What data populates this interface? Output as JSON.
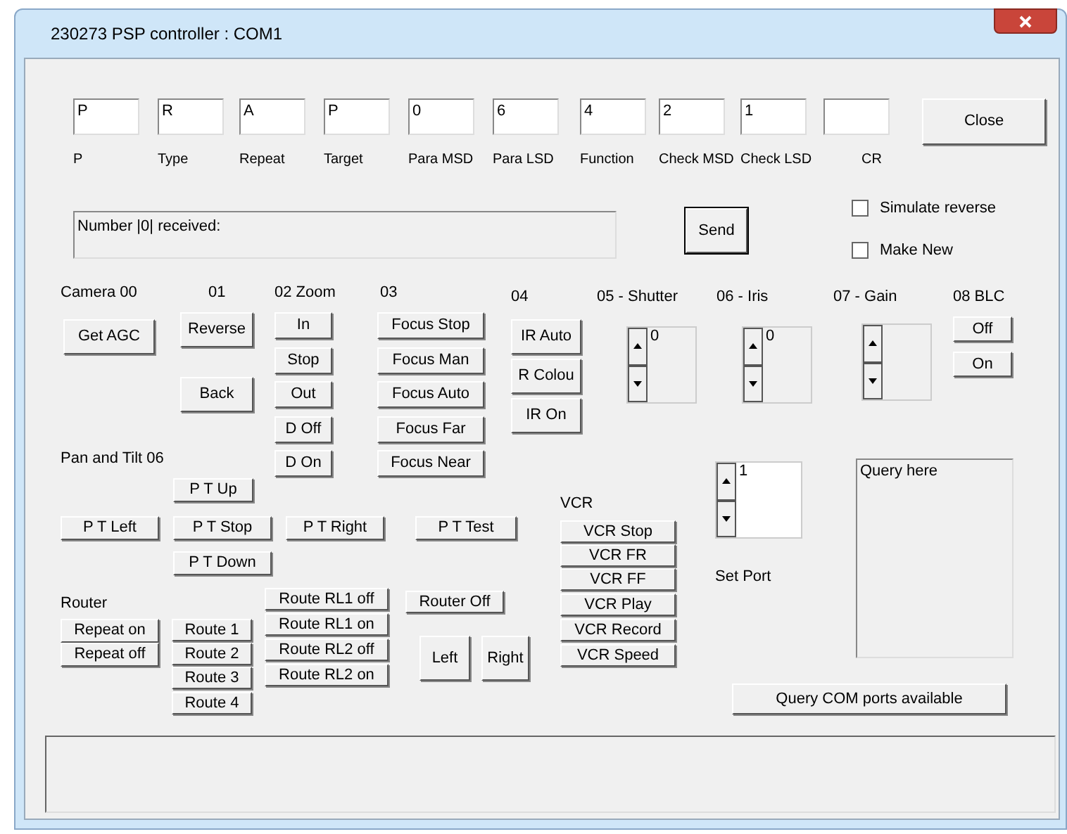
{
  "window": {
    "title": "230273 PSP controller : COM1"
  },
  "fields": [
    {
      "value": "P",
      "label": "P"
    },
    {
      "value": "R",
      "label": "Type"
    },
    {
      "value": "A",
      "label": "Repeat"
    },
    {
      "value": "P",
      "label": "Target"
    },
    {
      "value": "0",
      "label": "Para MSD"
    },
    {
      "value": "6",
      "label": "Para LSD"
    },
    {
      "value": "4",
      "label": "Function"
    },
    {
      "value": "2",
      "label": "Check MSD"
    },
    {
      "value": "1",
      "label": "Check LSD"
    },
    {
      "label": "CR"
    }
  ],
  "close_button": "Close",
  "message_box": "Number |0| received:",
  "send_button": "Send",
  "checkboxes": [
    {
      "label": "Simulate reverse",
      "checked": false
    },
    {
      "label": "Make New",
      "checked": false
    }
  ],
  "headings": [
    "Camera 00",
    "01",
    "02 Zoom",
    "03",
    "04",
    "05 - Shutter",
    "06 - Iris",
    "07 - Gain",
    "08 BLC",
    "Pan and Tilt 06",
    "VCR",
    "Router",
    "Set Port"
  ],
  "buttons": [
    "Get AGC",
    "Reverse",
    "Back",
    "In",
    "Stop",
    "Out",
    "D Off",
    "D On",
    "Focus Stop",
    "Focus Man",
    "Focus Auto",
    "Focus Far",
    "Focus Near",
    "IR Auto",
    "R Colou",
    "IR On",
    "Off",
    "On",
    "P T Up",
    "P T Left",
    "P T Stop",
    "P T Right",
    "P T Test",
    "P T Down",
    "VCR Stop",
    "VCR FR",
    "VCR FF",
    "VCR Play",
    "VCR Record",
    "VCR Speed",
    "Repeat on",
    "Repeat off",
    "Route 1",
    "Route 2",
    "Route 3",
    "Route 4",
    "Route RL1 off",
    "Route RL1 on",
    "Route RL2 off",
    "Route RL2 on",
    "Router Off",
    "Left",
    "Right",
    "Query COM ports available"
  ],
  "spinners": [
    {
      "value": "0",
      "disabled": true
    },
    {
      "value": "0",
      "disabled": true
    },
    {
      "disabled": true
    },
    {
      "value": "1",
      "disabled": false
    }
  ],
  "query_box": "Query here"
}
